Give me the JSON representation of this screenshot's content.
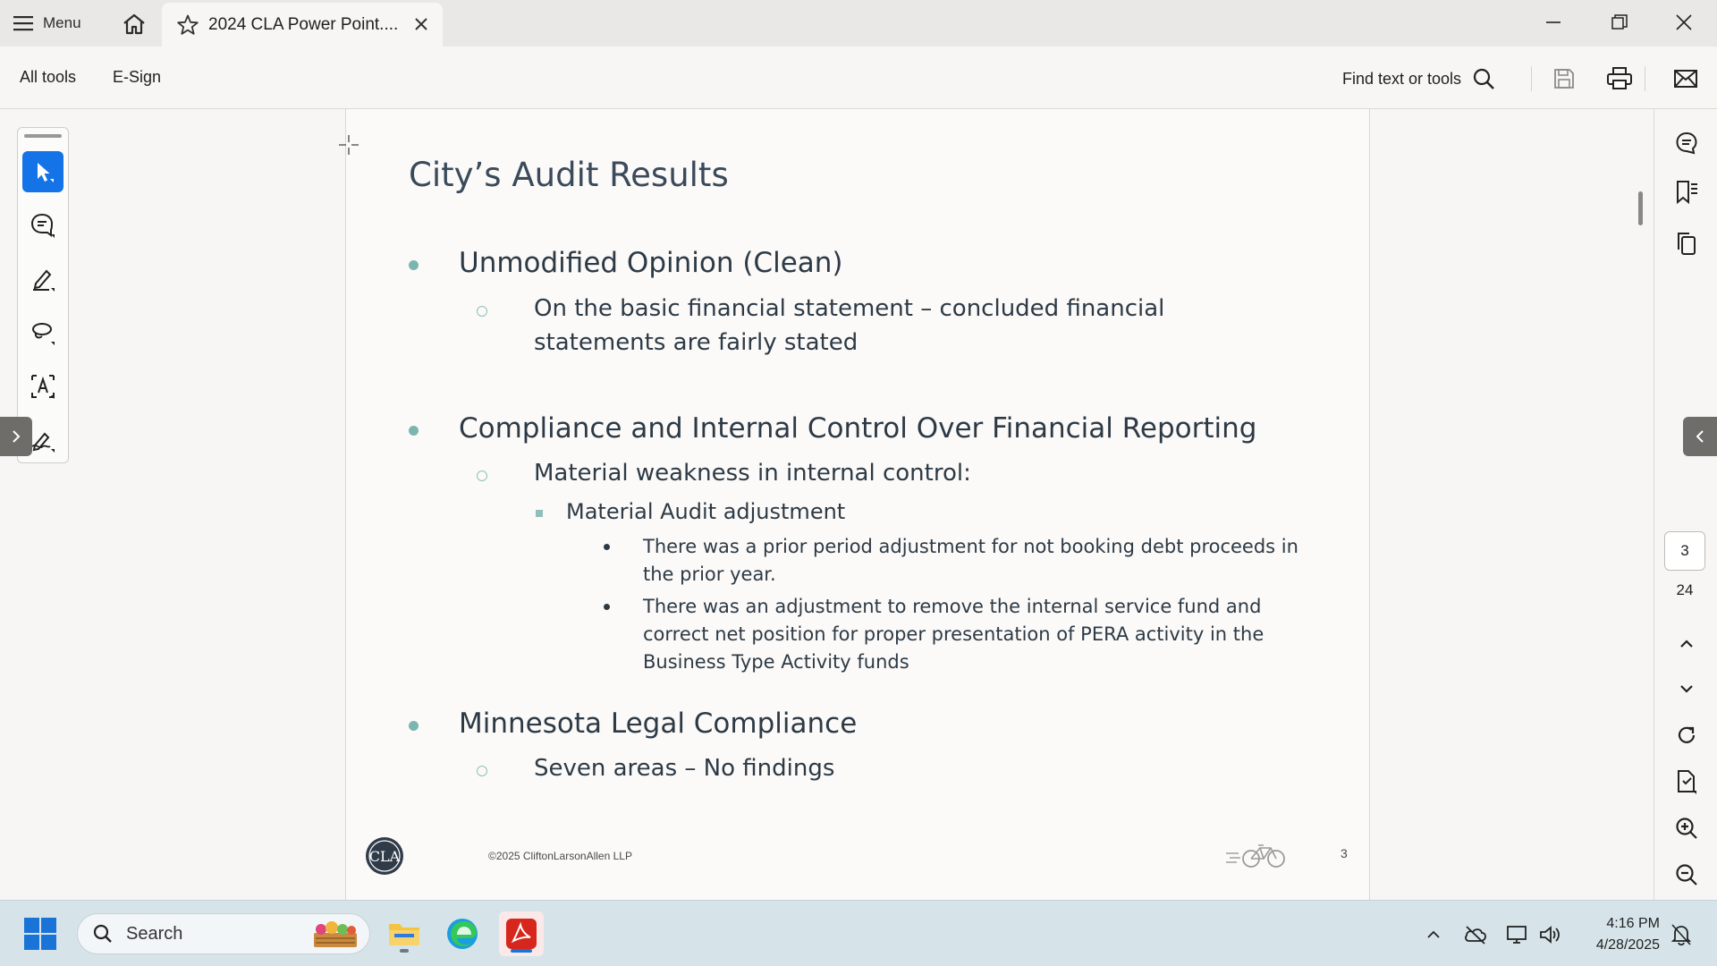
{
  "titlebar": {
    "menu_label": "Menu",
    "tab_title": "2024 CLA Power Point...."
  },
  "commandbar": {
    "all_tools": "All tools",
    "esign": "E-Sign",
    "find_placeholder": "Find text or tools"
  },
  "tools": [
    "select-icon",
    "comment-icon",
    "highlight-pen-icon",
    "lasso-draw-icon",
    "text-recognition-icon",
    "sign-icon"
  ],
  "slide": {
    "title": "City’s Audit Results",
    "sections": [
      {
        "heading": "Unmodified Opinion (Clean)",
        "sub": "On the basic financial statement – concluded financial statements are fairly stated"
      },
      {
        "heading": "Compliance and Internal Control Over Financial Reporting",
        "sub": "Material weakness in internal control:",
        "subsub": "Material Audit adjustment",
        "points": [
          "There was a prior period adjustment for not booking debt proceeds in the prior year.",
          "There was an adjustment to remove the internal service fund and correct net position for proper presentation of PERA activity in the Business Type Activity funds"
        ]
      },
      {
        "heading": "Minnesota Legal Compliance",
        "sub": "Seven areas – No findings"
      }
    ],
    "footer_copyright": "©2025 CliftonLarsonAllen LLP",
    "footer_page": "3",
    "logo_text": "CLA"
  },
  "navigation": {
    "current_page": "3",
    "total_pages": "24"
  },
  "taskbar": {
    "search_label": "Search",
    "time": "4:16 PM",
    "date": "4/28/2025"
  },
  "colors": {
    "accent": "#1473e6",
    "bullet_teal": "#7bb5b0",
    "title_text": "#3a4a5a",
    "acrobat_red": "#d7261b"
  }
}
